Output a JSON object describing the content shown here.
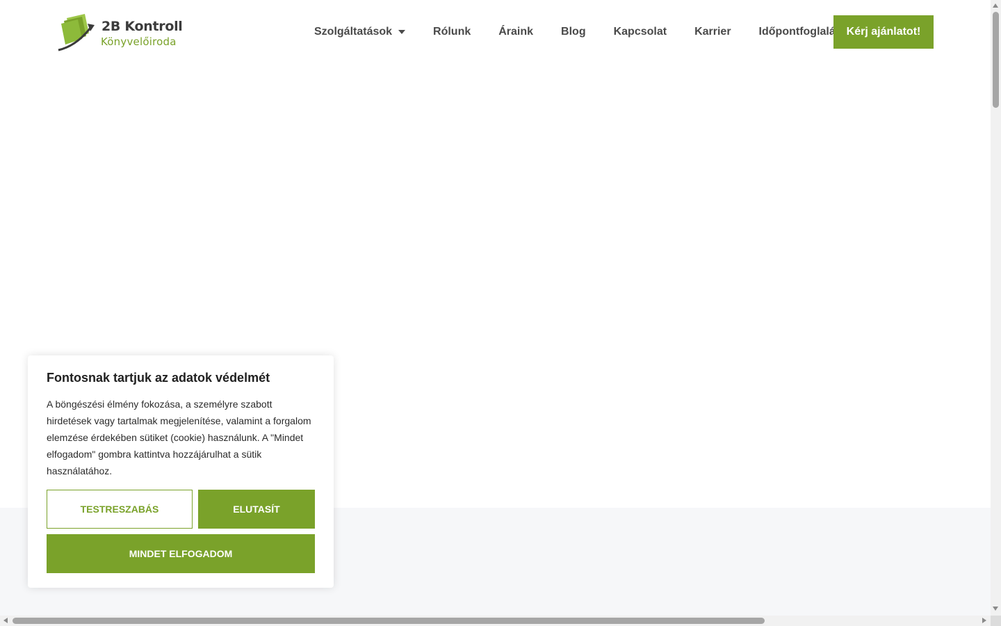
{
  "header": {
    "logo": {
      "title": "2B Kontroll",
      "subtitle": "Könyvelőiroda",
      "icon": "book-arrow-logo-icon"
    },
    "nav": [
      {
        "label": "Szolgáltatások",
        "has_dropdown": true
      },
      {
        "label": "Rólunk"
      },
      {
        "label": "Áraink"
      },
      {
        "label": "Blog"
      },
      {
        "label": "Kapcsolat"
      },
      {
        "label": "Karrier"
      },
      {
        "label": "Időpontfoglalás"
      }
    ],
    "cta_label": "Kérj ajánlatot!"
  },
  "cookie_banner": {
    "title": "Fontosnak tartjuk az adatok védelmét",
    "text": "A böngészési élmény fokozása, a személyre szabott hirdetések vagy tartalmak megjelenítése, valamint a forgalom elemzése érdekében sütiket (cookie) használunk. A \"Mindet elfogadom\" gombra kattintva hozzájárulhat a sütik használatához.",
    "customize_label": "TESTRESZABÁS",
    "reject_label": "ELUTASÍT",
    "accept_all_label": "MINDET ELFOGADOM"
  },
  "colors": {
    "accent": "#7aa22a",
    "nav_text": "#4a4a4a",
    "section_bg": "#f6f7f9"
  }
}
